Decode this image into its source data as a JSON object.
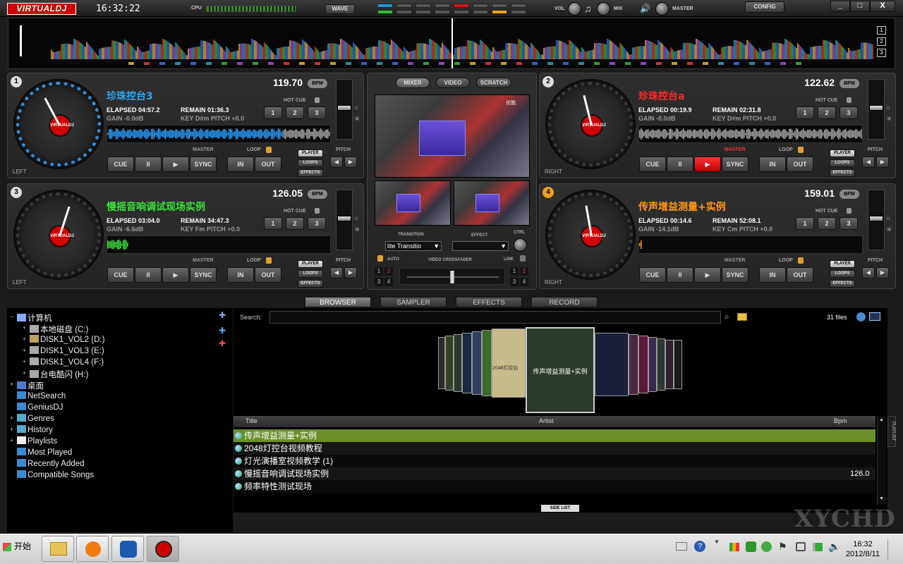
{
  "app": {
    "logo": "VIRTUALDJ",
    "clock": "16:32:22",
    "cpu_label": "CPU",
    "wave_btn": "WAVE",
    "vol_label": "VOL",
    "mix_label": "MIX",
    "master_label": "MASTER",
    "config_btn": "CONFIG",
    "win_min": "_",
    "win_max": "□",
    "win_close": "X"
  },
  "overview": {
    "bank_labels": [
      "1",
      "2",
      "3"
    ]
  },
  "decks": [
    {
      "num": "1",
      "side": "LEFT",
      "title": "珍珠控台3",
      "bpm": "119.70",
      "bpm_label": "BPM",
      "elapsed": "ELAPSED 04:57.2",
      "remain": "REMAIN 01:36.3",
      "gain": "GAIN -0.0dB",
      "key": "KEY D#m PITCH +0.0",
      "hot_cue": "HOT CUE",
      "hot": [
        "1",
        "2",
        "3"
      ],
      "master": "MASTER",
      "loop": "LOOP",
      "cue": "CUE",
      "pause": "II",
      "play": "▶",
      "sync": "SYNC",
      "in": "IN",
      "out": "OUT",
      "player": "PLAYER",
      "loops": "LOOPS",
      "effects": "EFFECTS",
      "pitch": "PITCH",
      "color": "#2fa8f0"
    },
    {
      "num": "2",
      "side": "RIGHT",
      "title": "珍珠控台a",
      "bpm": "122.62",
      "bpm_label": "BPM",
      "elapsed": "ELAPSED 00:19.9",
      "remain": "REMAIN 02:31.8",
      "gain": "GAIN -0.0dB",
      "key": "KEY D#m PITCH +0.0",
      "hot_cue": "HOT CUE",
      "hot": [
        "1",
        "2",
        "3"
      ],
      "master": "MASTER",
      "loop": "LOOP",
      "cue": "CUE",
      "pause": "II",
      "play": "▶",
      "sync": "SYNC",
      "in": "IN",
      "out": "OUT",
      "player": "PLAYER",
      "loops": "LOOPS",
      "effects": "EFFECTS",
      "pitch": "PITCH",
      "color": "#ff2a2a"
    },
    {
      "num": "3",
      "side": "LEFT",
      "title": "慢摇音响调试现场实例",
      "bpm": "126.05",
      "bpm_label": "BPM",
      "elapsed": "ELAPSED 03:04.0",
      "remain": "REMAIN 34:47.3",
      "gain": "GAIN -6.6dB",
      "key": "KEY Fm   PITCH +0.0",
      "hot_cue": "HOT CUE",
      "hot": [
        "1",
        "2",
        "3"
      ],
      "master": "MASTER",
      "loop": "LOOP",
      "cue": "CUE",
      "pause": "II",
      "play": "▶",
      "sync": "SYNC",
      "in": "IN",
      "out": "OUT",
      "player": "PLAYER",
      "loops": "LOOPS",
      "effects": "EFFECTS",
      "pitch": "PITCH",
      "color": "#3be03b"
    },
    {
      "num": "4",
      "side": "RIGHT",
      "title": "传声增益测量+实例",
      "bpm": "159.01",
      "bpm_label": "BPM",
      "elapsed": "ELAPSED 00:14.6",
      "remain": "REMAIN 52:08.1",
      "gain": "GAIN -14.1dB",
      "key": "KEY Cm   PITCH +0.0",
      "hot_cue": "HOT CUE",
      "hot": [
        "1",
        "2",
        "3"
      ],
      "master": "MASTER",
      "loop": "LOOP",
      "cue": "CUE",
      "pause": "II",
      "play": "▶",
      "sync": "SYNC",
      "in": "IN",
      "out": "OUT",
      "player": "PLAYER",
      "loops": "LOOPS",
      "effects": "EFFECTS",
      "pitch": "PITCH",
      "color": "#ff9a10"
    }
  ],
  "mixer": {
    "tabs": [
      "MIXER",
      "VIDEO",
      "SCRATCH"
    ],
    "transition_label": "TRANSITION",
    "effect_label": "EFFECT",
    "ctrl_label": "CTRL",
    "transition_value": "lite Transitio",
    "auto": "AUTO",
    "crossfader": "VIDEO CROSSFADER",
    "link": "LINK",
    "left_nums": [
      "1",
      "2",
      "3",
      "4"
    ],
    "right_nums": [
      "1",
      "2",
      "3",
      "4"
    ],
    "video_caption": "优酷"
  },
  "browser_tabs": [
    "BROWSER",
    "SAMPLER",
    "EFFECTS",
    "RECORD"
  ],
  "tree": [
    {
      "label": "计算机",
      "depth": 0,
      "exp": "−"
    },
    {
      "label": "本地磁盘 (C:)",
      "depth": 1,
      "exp": "+"
    },
    {
      "label": "DISK1_VOL2 (D:)",
      "depth": 1,
      "exp": "+"
    },
    {
      "label": "DISK1_VOL3 (E:)",
      "depth": 1,
      "exp": "+"
    },
    {
      "label": "DISK1_VOL4 (F:)",
      "depth": 1,
      "exp": "+"
    },
    {
      "label": "台电酷闪 (H:)",
      "depth": 1,
      "exp": "+"
    },
    {
      "label": "桌面",
      "depth": 0,
      "exp": "+"
    },
    {
      "label": "NetSearch",
      "depth": 0,
      "exp": ""
    },
    {
      "label": "GeniusDJ",
      "depth": 0,
      "exp": ""
    },
    {
      "label": "Genres",
      "depth": 0,
      "exp": "+"
    },
    {
      "label": "History",
      "depth": 0,
      "exp": "+"
    },
    {
      "label": "Playlists",
      "depth": 0,
      "exp": "+"
    },
    {
      "label": "Most Played",
      "depth": 0,
      "exp": ""
    },
    {
      "label": "Recently Added",
      "depth": 0,
      "exp": ""
    },
    {
      "label": "Compatible Songs",
      "depth": 0,
      "exp": ""
    }
  ],
  "search": {
    "label": "Search:",
    "value": "",
    "files": "31 files"
  },
  "cover_center": "传声增益测量+实例",
  "cover_left_text": "2048灯控台",
  "columns": {
    "title": "Title",
    "artist": "Artist",
    "bpm": "Bpm"
  },
  "tracks": [
    {
      "title": "传声增益测量+实例",
      "artist": "",
      "bpm": ""
    },
    {
      "title": "2048灯控台视频教程",
      "artist": "",
      "bpm": ""
    },
    {
      "title": "灯光演播室视频教学 (1)",
      "artist": "",
      "bpm": ""
    },
    {
      "title": "慢摇音响调试现场实例",
      "artist": "",
      "bpm": "126.0"
    },
    {
      "title": "频率特性测试现场",
      "artist": "",
      "bpm": ""
    }
  ],
  "side_list": "SIDE LIST",
  "playlist_tab": "PLAYLIST",
  "taskbar": {
    "start": "开始",
    "time": "16:32",
    "date": "2012/8/11"
  },
  "watermark": "XYCHD"
}
